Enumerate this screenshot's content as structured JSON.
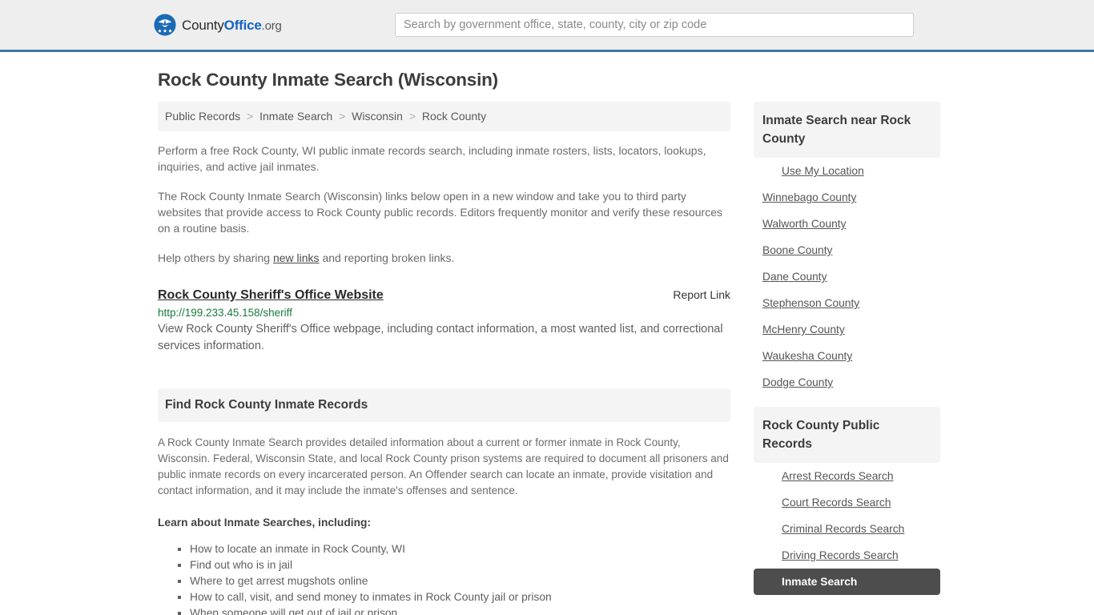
{
  "header": {
    "brand": {
      "logo_icon": "eagle-shield-icon",
      "part1": "County",
      "part2": "Office",
      "part3": ".org"
    },
    "search": {
      "placeholder": "Search by government office, state, county, city or zip code",
      "value": ""
    }
  },
  "page": {
    "title": "Rock County Inmate Search (Wisconsin)"
  },
  "breadcrumb": {
    "items": [
      "Public Records",
      "Inmate Search",
      "Wisconsin",
      "Rock County"
    ],
    "separator": ">"
  },
  "intro": {
    "p1": "Perform a free Rock County, WI public inmate records search, including inmate rosters, lists, locators, lookups, inquiries, and active jail inmates.",
    "p2": "The Rock County Inmate Search (Wisconsin) links below open in a new window and take you to third party websites that provide access to Rock County public records. Editors frequently monitor and verify these resources on a routine basis.",
    "p3_before": "Help others by sharing ",
    "p3_link": "new links",
    "p3_after": " and reporting broken links."
  },
  "result": {
    "title": "Rock County Sheriff's Office Website",
    "report_label": "Report Link",
    "url": "http://199.233.45.158/sheriff",
    "description": "View Rock County Sheriff's Office webpage, including contact information, a most wanted list, and correctional services information."
  },
  "records_section": {
    "heading": "Find Rock County Inmate Records",
    "body": "A Rock County Inmate Search provides detailed information about a current or former inmate in Rock County, Wisconsin. Federal, Wisconsin State, and local Rock County prison systems are required to document all prisoners and public inmate records on every incarcerated person. An Offender search can locate an inmate, provide visitation and contact information, and it may include the inmate's offenses and sentence.",
    "subheading": "Learn about Inmate Searches, including:",
    "bullets": [
      "How to locate an inmate in Rock County, WI",
      "Find out who is in jail",
      "Where to get arrest mugshots online",
      "How to call, visit, and send money to inmates in Rock County jail or prison",
      "When someone will get out of jail or prison"
    ]
  },
  "sidebar": {
    "near_card": {
      "heading": "Inmate Search near Rock County",
      "items": [
        {
          "label": "Use My Location",
          "indented": true,
          "active": false
        },
        {
          "label": "Winnebago County",
          "indented": false,
          "active": false
        },
        {
          "label": "Walworth County",
          "indented": false,
          "active": false
        },
        {
          "label": "Boone County",
          "indented": false,
          "active": false
        },
        {
          "label": "Dane County",
          "indented": false,
          "active": false
        },
        {
          "label": "Stephenson County",
          "indented": false,
          "active": false
        },
        {
          "label": "McHenry County",
          "indented": false,
          "active": false
        },
        {
          "label": "Waukesha County",
          "indented": false,
          "active": false
        },
        {
          "label": "Dodge County",
          "indented": false,
          "active": false
        }
      ]
    },
    "records_card": {
      "heading": "Rock County Public Records",
      "items": [
        {
          "label": "Arrest Records Search",
          "indented": true,
          "active": false
        },
        {
          "label": "Court Records Search",
          "indented": true,
          "active": false
        },
        {
          "label": "Criminal Records Search",
          "indented": true,
          "active": false
        },
        {
          "label": "Driving Records Search",
          "indented": true,
          "active": false
        },
        {
          "label": "Inmate Search",
          "indented": true,
          "active": true
        }
      ]
    }
  },
  "colors": {
    "header_bg": "#eeeeee",
    "header_border": "#3a76a8",
    "brand_blue": "#1565c0",
    "panel_bg": "#f4f4f4",
    "url_green": "#1a7a3c",
    "active_bg": "#4d4d4d"
  }
}
